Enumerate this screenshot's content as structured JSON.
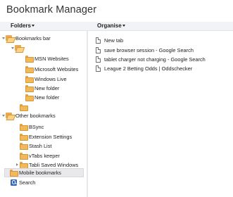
{
  "app": {
    "title": "Bookmark Manager"
  },
  "header": {
    "folders_label": "Folders",
    "organise_label": "Organise"
  },
  "tree": {
    "bookmarks_bar": "Bookmarks bar",
    "bb_children": {
      "unnamed_folder": "",
      "items": [
        "MSN Websites",
        "Microsoft Websites",
        "Windows Live",
        "New folder",
        "New folder"
      ],
      "empty_folder": ""
    },
    "other_bookmarks": "Other bookmarks",
    "other_children": [
      "BSync",
      "Extension Settings",
      "Stash List",
      "vTabs keeper",
      "Tabli Saved Windows"
    ],
    "mobile_bookmarks": "Mobile bookmarks",
    "search": "Search"
  },
  "bookmarks": [
    {
      "title": "New tab"
    },
    {
      "title": "save browser session - Google Search"
    },
    {
      "title": "tablet charger not charging - Google Search"
    },
    {
      "title": "League 2 Betting Odds | Oddschecker"
    }
  ],
  "colors": {
    "folder": "#f0b95a",
    "header_bg": "#f1f3f6",
    "selected_bg": "#e9e9ec",
    "search_icon": "#3566b8"
  }
}
